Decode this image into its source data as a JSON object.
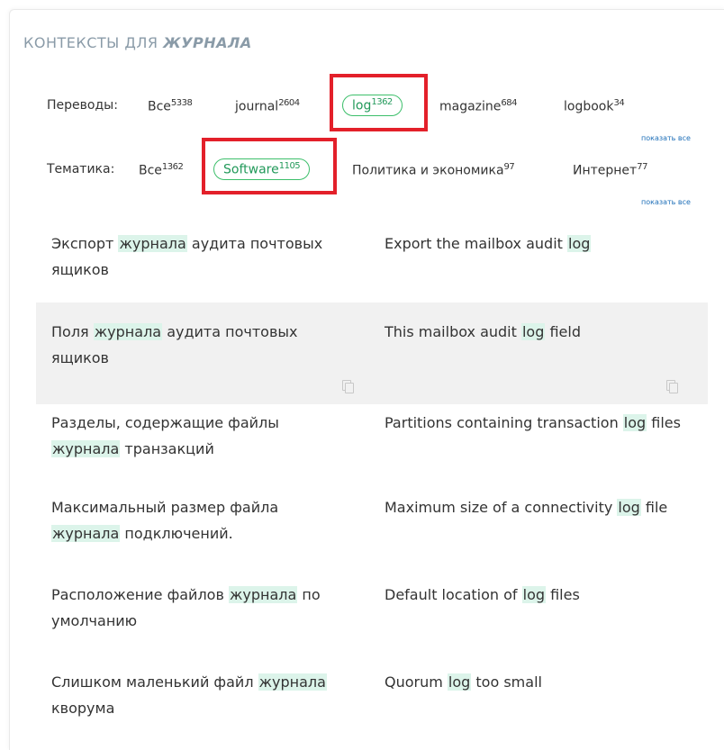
{
  "section": {
    "heading_prefix": "КОНТЕКСТЫ ДЛЯ",
    "heading_term": "ЖУРНАЛА"
  },
  "translations": {
    "label": "Переводы:",
    "items": [
      {
        "label": "Все",
        "count": "5338",
        "active": false
      },
      {
        "label": "journal",
        "count": "2604",
        "active": false
      },
      {
        "label": "log",
        "count": "1362",
        "active": true
      },
      {
        "label": "magazine",
        "count": "684",
        "active": false
      },
      {
        "label": "logbook",
        "count": "34",
        "active": false
      }
    ],
    "show_all": "показать все"
  },
  "topics": {
    "label": "Тематика:",
    "items": [
      {
        "label": "Все",
        "count": "1362",
        "active": false
      },
      {
        "label": "Software",
        "count": "1105",
        "active": true
      },
      {
        "label": "Политика и экономика",
        "count": "97",
        "active": false
      },
      {
        "label": "Интернет",
        "count": "77",
        "active": false
      }
    ],
    "show_all": "показать все"
  },
  "examples": [
    {
      "src": [
        "Экспорт ",
        "журнала",
        " аудита почтовых ящиков"
      ],
      "tgt": [
        "Export the mailbox audit ",
        "log",
        ""
      ]
    },
    {
      "src": [
        "Поля ",
        "журнала",
        " аудита почтовых ящиков"
      ],
      "tgt": [
        "This mailbox audit ",
        "log",
        " field"
      ]
    },
    {
      "src": [
        "Разделы, содержащие файлы ",
        "журнала",
        " транзакций"
      ],
      "tgt": [
        "Partitions containing transaction ",
        "log",
        " files"
      ]
    },
    {
      "src": [
        "Максимальный размер файла ",
        "журнала",
        " подключений."
      ],
      "tgt": [
        "Maximum size of a connectivity ",
        "log",
        " file"
      ]
    },
    {
      "src": [
        "Расположение файлов ",
        "журнала",
        " по умолчанию"
      ],
      "tgt": [
        "Default location of ",
        "log",
        " files"
      ]
    },
    {
      "src": [
        "Слишком маленький файл ",
        "журнала",
        " кворума"
      ],
      "tgt": [
        "Quorum ",
        "log",
        " too small"
      ]
    }
  ],
  "colors": {
    "accent_green": "#3dbf6b",
    "highlight_bg": "#dcf4ea",
    "annotation_red": "#e3202a",
    "link_blue": "#1e6fb8"
  }
}
